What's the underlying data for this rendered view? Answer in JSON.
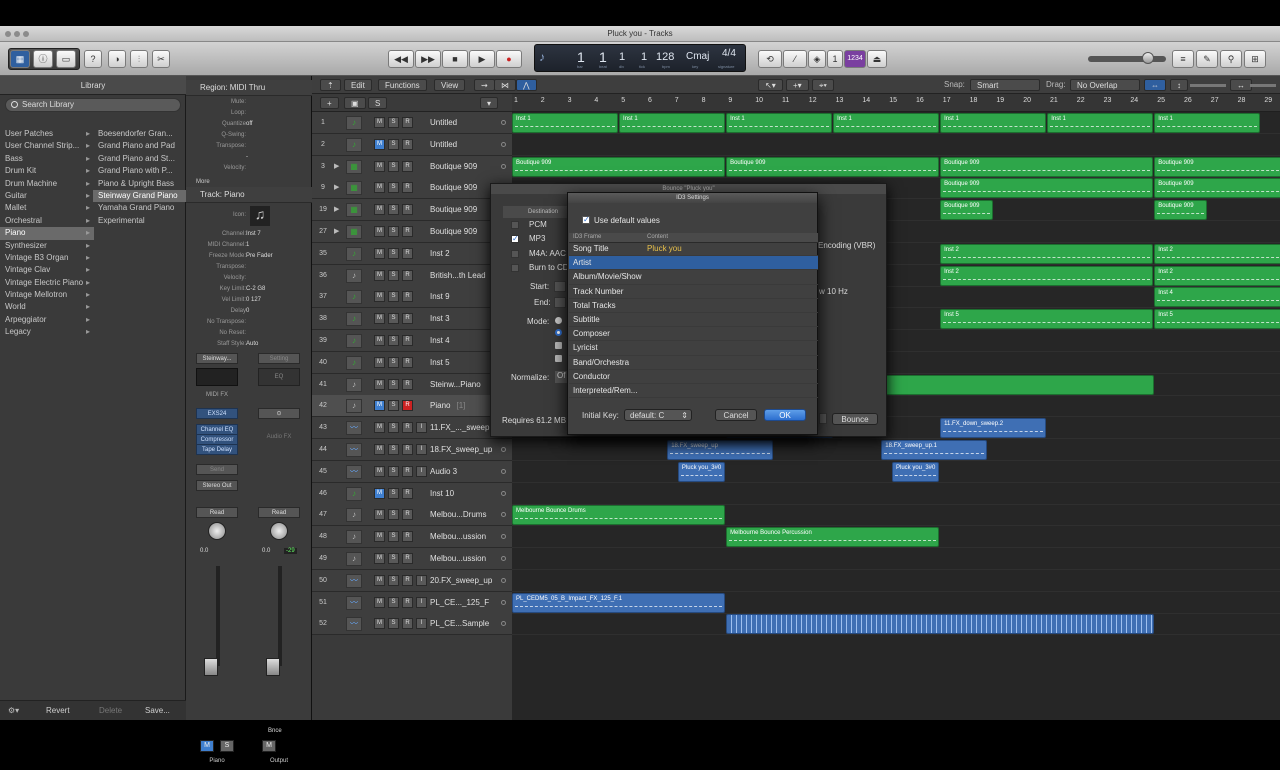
{
  "window": {
    "title": "Pluck you - Tracks"
  },
  "lcd": {
    "bar": "1",
    "beat": "1",
    "div": "1",
    "tick": "1",
    "bar_l": "bar",
    "beat_l": "beat",
    "div_l": "div",
    "tick_l": "tick",
    "tempo": "128",
    "tempo_l": "bpm",
    "key": "Cmaj",
    "key_l": "key",
    "sig": "4/4",
    "sig_l": "signature",
    "cpu": "1234"
  },
  "library": {
    "title": "Library",
    "search_placeholder": "Search Library",
    "categories": [
      {
        "label": "User Patches"
      },
      {
        "label": "User Channel Strip..."
      },
      {
        "label": "Bass"
      },
      {
        "label": "Drum Kit"
      },
      {
        "label": "Drum Machine"
      },
      {
        "label": "Guitar"
      },
      {
        "label": "Mallet"
      },
      {
        "label": "Orchestral"
      },
      {
        "label": "Piano"
      },
      {
        "label": "Synthesizer"
      },
      {
        "label": "Vintage B3 Organ"
      },
      {
        "label": "Vintage Clav"
      },
      {
        "label": "Vintage Electric Piano"
      },
      {
        "label": "Vintage Mellotron"
      },
      {
        "label": "World"
      },
      {
        "label": "Arpeggiator"
      },
      {
        "label": "Legacy"
      }
    ],
    "patches": [
      {
        "label": "Boesendorfer Gran..."
      },
      {
        "label": "Grand Piano and Pad"
      },
      {
        "label": "Grand Piano and St..."
      },
      {
        "label": "Grand Piano with P..."
      },
      {
        "label": "Piano & Upright Bass"
      },
      {
        "label": "Steinway Grand Piano"
      },
      {
        "label": "Yamaha Grand Piano"
      },
      {
        "label": "Experimental"
      }
    ],
    "revert": "Revert",
    "delete": "Delete",
    "save": "Save..."
  },
  "inspector": {
    "region_title": "Region: MIDI Thru",
    "region_params": [
      {
        "k": "Mute:",
        "v": ""
      },
      {
        "k": "Loop:",
        "v": ""
      },
      {
        "k": "Quantize",
        "v": "off"
      },
      {
        "k": "Q-Swing:",
        "v": ""
      },
      {
        "k": "Transpose:",
        "v": ""
      },
      {
        "k": "",
        "v": "-"
      },
      {
        "k": "Velocity:",
        "v": ""
      }
    ],
    "more": "More",
    "track_title": "Track: Piano",
    "icon_label": "Icon:",
    "track_params": [
      {
        "k": "Channel:",
        "v": "Inst 7"
      },
      {
        "k": "MIDI Channel:",
        "v": "1"
      },
      {
        "k": "Freeze Mode:",
        "v": "Pre Fader"
      },
      {
        "k": "Transpose:",
        "v": ""
      },
      {
        "k": "Velocity:",
        "v": ""
      },
      {
        "k": "Key Limit:",
        "v": "C-2     G8"
      },
      {
        "k": "Vel Limit:",
        "v": "0      127"
      },
      {
        "k": "Delay",
        "v": "0"
      },
      {
        "k": "No Transpose:",
        "v": ""
      },
      {
        "k": "No Reset:",
        "v": ""
      },
      {
        "k": "Staff Style:",
        "v": "Auto"
      }
    ],
    "strip1": {
      "setting": "Steinway...",
      "midi_fx": "MIDI FX",
      "instrument": "EXS24",
      "plugins": [
        "Channel EQ",
        "Compressor",
        "Tape Delay"
      ],
      "send": "Send",
      "output": "Stereo Out",
      "read": "Read",
      "vol": "0.0",
      "m": "M",
      "s": "S",
      "name": "Piano"
    },
    "strip2": {
      "setting": "Setting",
      "eq": "EQ",
      "audio_fx": "Audio FX",
      "read": "Read",
      "vol": "0.0",
      "peak": "-29",
      "m": "M",
      "bnce": "Bnce",
      "name": "Output"
    }
  },
  "tracks_toolbar": {
    "edit": "Edit",
    "functions": "Functions",
    "view": "View",
    "snap_label": "Snap:",
    "snap_value": "Smart",
    "drag_label": "Drag:",
    "drag_value": "No Overlap"
  },
  "ruler": [
    "1",
    "3",
    "5",
    "7",
    "9",
    "11",
    "13",
    "15",
    "17",
    "19",
    "21",
    "23",
    "25",
    "27",
    "29",
    "2",
    "4",
    "6",
    "8",
    "10",
    "12",
    "14",
    "16",
    "18",
    "20",
    "22",
    "24",
    "26",
    "28"
  ],
  "tracks": [
    {
      "num": "1",
      "name": "Untitled"
    },
    {
      "num": "2",
      "name": "Untitled"
    },
    {
      "num": "3",
      "name": "Boutique 909"
    },
    {
      "num": "9",
      "name": "Boutique 909"
    },
    {
      "num": "19",
      "name": "Boutique 909"
    },
    {
      "num": "27",
      "name": "Boutique 909"
    },
    {
      "num": "35",
      "name": "Inst 2"
    },
    {
      "num": "36",
      "name": "British...th Lead"
    },
    {
      "num": "37",
      "name": "Inst 9"
    },
    {
      "num": "38",
      "name": "Inst 3"
    },
    {
      "num": "39",
      "name": "Inst 4"
    },
    {
      "num": "40",
      "name": "Inst 5"
    },
    {
      "num": "41",
      "name": "Steinw...Piano"
    },
    {
      "num": "42",
      "name": "Piano",
      "extra": "[1]"
    },
    {
      "num": "43",
      "name": "11.FX_..._sweep"
    },
    {
      "num": "44",
      "name": "18.FX_sweep_up"
    },
    {
      "num": "45",
      "name": "Audio 3"
    },
    {
      "num": "46",
      "name": "Inst 10"
    },
    {
      "num": "47",
      "name": "Melbou...Drums"
    },
    {
      "num": "48",
      "name": "Melbou...ussion"
    },
    {
      "num": "49",
      "name": "Melbou...ussion"
    },
    {
      "num": "50",
      "name": "20.FX_sweep_up"
    },
    {
      "num": "51",
      "name": "PL_CE..._125_F"
    },
    {
      "num": "52",
      "name": "PL_CE...Sample"
    }
  ],
  "regions": [
    {
      "label": "Inst 1"
    },
    {
      "label": "Inst 1"
    },
    {
      "label": "Inst 1"
    },
    {
      "label": "Inst 1"
    },
    {
      "label": "Inst 1"
    },
    {
      "label": "Inst 1"
    },
    {
      "label": "Inst 1"
    },
    {
      "label": "Boutique 909"
    },
    {
      "label": "Boutique 909"
    },
    {
      "label": "Boutique 909"
    },
    {
      "label": "Boutique 909"
    },
    {
      "label": "Boutique 909"
    },
    {
      "label": "Boutique 909"
    },
    {
      "label": "Boutique 909"
    },
    {
      "label": "Boutique 909"
    },
    {
      "label": "Inst 2"
    },
    {
      "label": "Inst 2"
    },
    {
      "label": "Inst 2"
    },
    {
      "label": "Inst 2"
    },
    {
      "label": "Inst 4"
    },
    {
      "label": "Inst 5"
    },
    {
      "label": "Inst 5"
    },
    {
      "label": "11.FX_down_sweep.2"
    },
    {
      "label": "18.FX_sweep_up"
    },
    {
      "label": "18.FX_sweep_up.1"
    },
    {
      "label": "Pluck you_3#0"
    },
    {
      "label": "Pluck you_3#0"
    },
    {
      "label": "Melbourne Bounce Drums"
    },
    {
      "label": "Melbourne Bounce Percussion"
    },
    {
      "label": "PL_CEDM5_05_B_Impact_FX_125_F.1"
    }
  ],
  "bounce": {
    "title": "Bounce \"Pluck you\"",
    "destination_hdr": "Destination",
    "destinations": [
      {
        "label": "PCM",
        "checked": false
      },
      {
        "label": "MP3",
        "checked": true
      },
      {
        "label": "M4A: AAC",
        "checked": false
      },
      {
        "label": "Burn to CD",
        "checked": false
      }
    ],
    "start": "Start:",
    "end": "End:",
    "mode": "Mode:",
    "normalize": "Normalize:",
    "normalize_v": "Of",
    "encoding": "Encoding (VBR)",
    "filter": "w 10 Hz",
    "requires": "Requires 61.2 MB o",
    "bounce_btn": "Bounce"
  },
  "id3": {
    "title": "ID3 Settings",
    "use_default": "Use default values",
    "col_frame": "ID3 Frame",
    "col_content": "Content",
    "rows": [
      {
        "frame": "Song Title",
        "content": "Pluck you"
      },
      {
        "frame": "Artist",
        "content": ""
      },
      {
        "frame": "Album/Movie/Show",
        "content": ""
      },
      {
        "frame": "Track Number",
        "content": ""
      },
      {
        "frame": "Total Tracks",
        "content": ""
      },
      {
        "frame": "Subtitle",
        "content": ""
      },
      {
        "frame": "Composer",
        "content": ""
      },
      {
        "frame": "Lyricist",
        "content": ""
      },
      {
        "frame": "Band/Orchestra",
        "content": ""
      },
      {
        "frame": "Conductor",
        "content": ""
      },
      {
        "frame": "Interpreted/Rem...",
        "content": ""
      }
    ],
    "initial_key_label": "Initial Key:",
    "initial_key_value": "default: C",
    "cancel": "Cancel",
    "ok": "OK"
  }
}
